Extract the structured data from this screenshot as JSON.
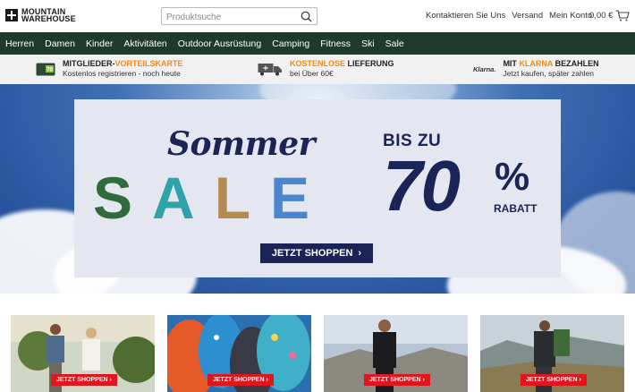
{
  "header": {
    "logo_line1": "MOUNTAIN",
    "logo_line2": "WAREHOUSE",
    "search_placeholder": "Produktsuche",
    "links": [
      "Kontaktieren Sie Uns",
      "Versand",
      "Mein Konto"
    ],
    "cart_total": "0,00 €"
  },
  "nav": {
    "items": [
      "Herren",
      "Damen",
      "Kinder",
      "Aktivitäten",
      "Outdoor Ausrüstung",
      "Camping",
      "Fitness",
      "Ski",
      "Sale"
    ]
  },
  "benefits": [
    {
      "title_pre": "MITGLIEDER-",
      "title_hl": "VORTEILSKARTE",
      "title_post": "",
      "sub": "Kostenlos registrieren - noch heute",
      "icon": "member-card-icon",
      "icon_text": "70"
    },
    {
      "title_pre": "",
      "title_hl": "KOSTENLOSE",
      "title_post": " LIEFERUNG",
      "sub": "bei Über 60€",
      "icon": "delivery-truck-icon"
    },
    {
      "title_pre": "MIT ",
      "title_hl": "KLARNA",
      "title_post": " BEZAHLEN",
      "sub": "Jetzt kaufen, später zahlen",
      "icon": "klarna-logo",
      "icon_text": "Klarna."
    }
  ],
  "hero": {
    "script_word": "Sommer",
    "sale_letters": [
      "S",
      "A",
      "L",
      "E"
    ],
    "bis_zu": "BIS ZU",
    "percent": "70",
    "percent_sign": "%",
    "rabatt": "RABATT",
    "cta": "JETZT SHOPPEN",
    "cta_icon": "chevron-right-icon"
  },
  "tiles": [
    {
      "cta": "JETZT SHOPPEN ›",
      "subject": "couple-summer-outdoor"
    },
    {
      "cta": "JETZT SHOPPEN ›",
      "subject": "sleeping-bags"
    },
    {
      "cta": "JETZT SHOPPEN ›",
      "subject": "wetsuit-beach"
    },
    {
      "cta": "JETZT SHOPPEN ›",
      "subject": "hiker-backpack"
    }
  ],
  "colors": {
    "nav_bg": "#1f3a2a",
    "accent_orange": "#f08a1c",
    "hero_navy": "#1a2456",
    "tile_button_red": "#e0161e"
  }
}
